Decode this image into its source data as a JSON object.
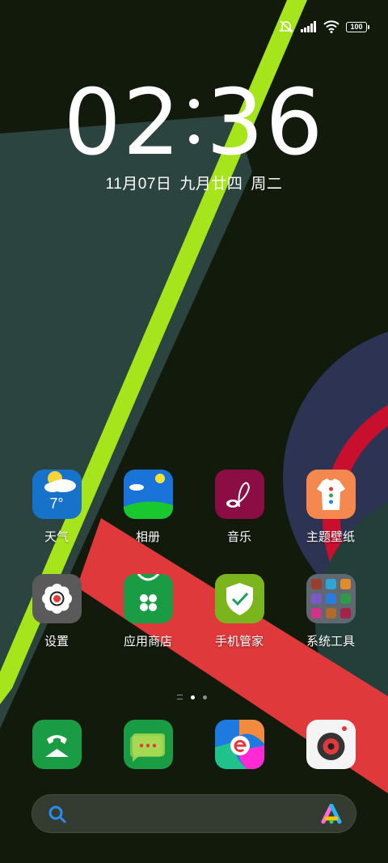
{
  "status_bar": {
    "icons": [
      "silent-icon",
      "signal-icon",
      "wifi-icon",
      "battery-icon"
    ],
    "battery": "100"
  },
  "clock": {
    "hours": "02",
    "minutes": "36"
  },
  "date": {
    "gregorian": "11月07日",
    "lunar": "九月廿四",
    "weekday": "周二"
  },
  "apps_row1": [
    {
      "label": "天气",
      "icon": "weather-icon",
      "temp": "7°"
    },
    {
      "label": "相册",
      "icon": "gallery-icon"
    },
    {
      "label": "音乐",
      "icon": "music-icon"
    },
    {
      "label": "主题壁纸",
      "icon": "themes-icon"
    }
  ],
  "apps_row2": [
    {
      "label": "设置",
      "icon": "settings-icon"
    },
    {
      "label": "应用商店",
      "icon": "app-store-icon"
    },
    {
      "label": "手机管家",
      "icon": "phone-manager-icon"
    },
    {
      "label": "系统工具",
      "icon": "system-tools-folder"
    }
  ],
  "dock": [
    {
      "icon": "phone-icon"
    },
    {
      "icon": "messages-icon"
    },
    {
      "icon": "browser-icon"
    },
    {
      "icon": "camera-icon"
    }
  ],
  "page_indicator": {
    "pages": 2,
    "current": 1
  },
  "colors": {
    "accent_green": "#a6e51c",
    "accent_red": "#e0393c",
    "panel_teal": "#2b4440",
    "navy": "#2d3352",
    "background": "#121a0c"
  }
}
